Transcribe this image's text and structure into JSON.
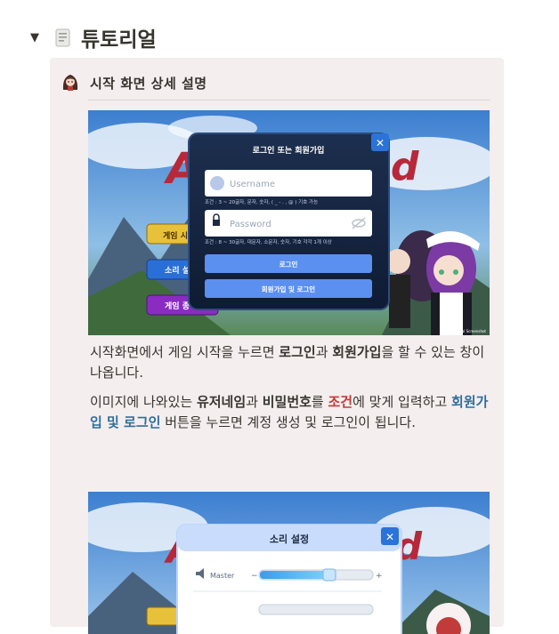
{
  "toggle": {
    "title": "튜토리얼",
    "arrow": "▼"
  },
  "callout": {
    "title": "시작 화면 상세 설명"
  },
  "shot1": {
    "dialog_title": "로그인 또는 회원가입",
    "username_placeholder": "Username",
    "username_hint": "조건 : 3 ~ 20글자, 문자, 숫자, ( _ - . , @ ) 기호 가능",
    "password_placeholder": "Password",
    "password_hint": "조건 : 8 ~ 30글자, 대문자, 소문자, 숫자, 기호 각각 1개 이상",
    "login_button": "로그인",
    "signup_button": "회원가입 및 로그인",
    "close_glyph": "✕",
    "logo_left": "A",
    "logo_right": "d",
    "menu_start": "게임 시",
    "menu_sound": "소리 설",
    "menu_quit": "게임 종",
    "watermark": "Tutorial Screenshot"
  },
  "para1": {
    "t1": "시작화면에서 게임 시작을 누르면 ",
    "b1": "로그인",
    "t2": "과 ",
    "b2": "회원가입",
    "t3": "을 할 수 있는 창이 나옵니다."
  },
  "para2": {
    "t1": "이미지에 나와있는 ",
    "b1": "유저네임",
    "t2": "과 ",
    "b2": "비밀번호",
    "t3": "를 ",
    "r1": "조건",
    "t4": "에 맞게 입력하고 ",
    "bl1": "회원가입 및 로그인",
    "t5": " 버튼을 누르면 계정 생성 및 로그인이 됩니다."
  },
  "shot2": {
    "dialog_title": "소리 설정",
    "master_label": "Master",
    "master_level": 0.62,
    "close_glyph": "✕",
    "logo_left": "A",
    "logo_right": "d",
    "minus": "−",
    "plus": "+"
  }
}
